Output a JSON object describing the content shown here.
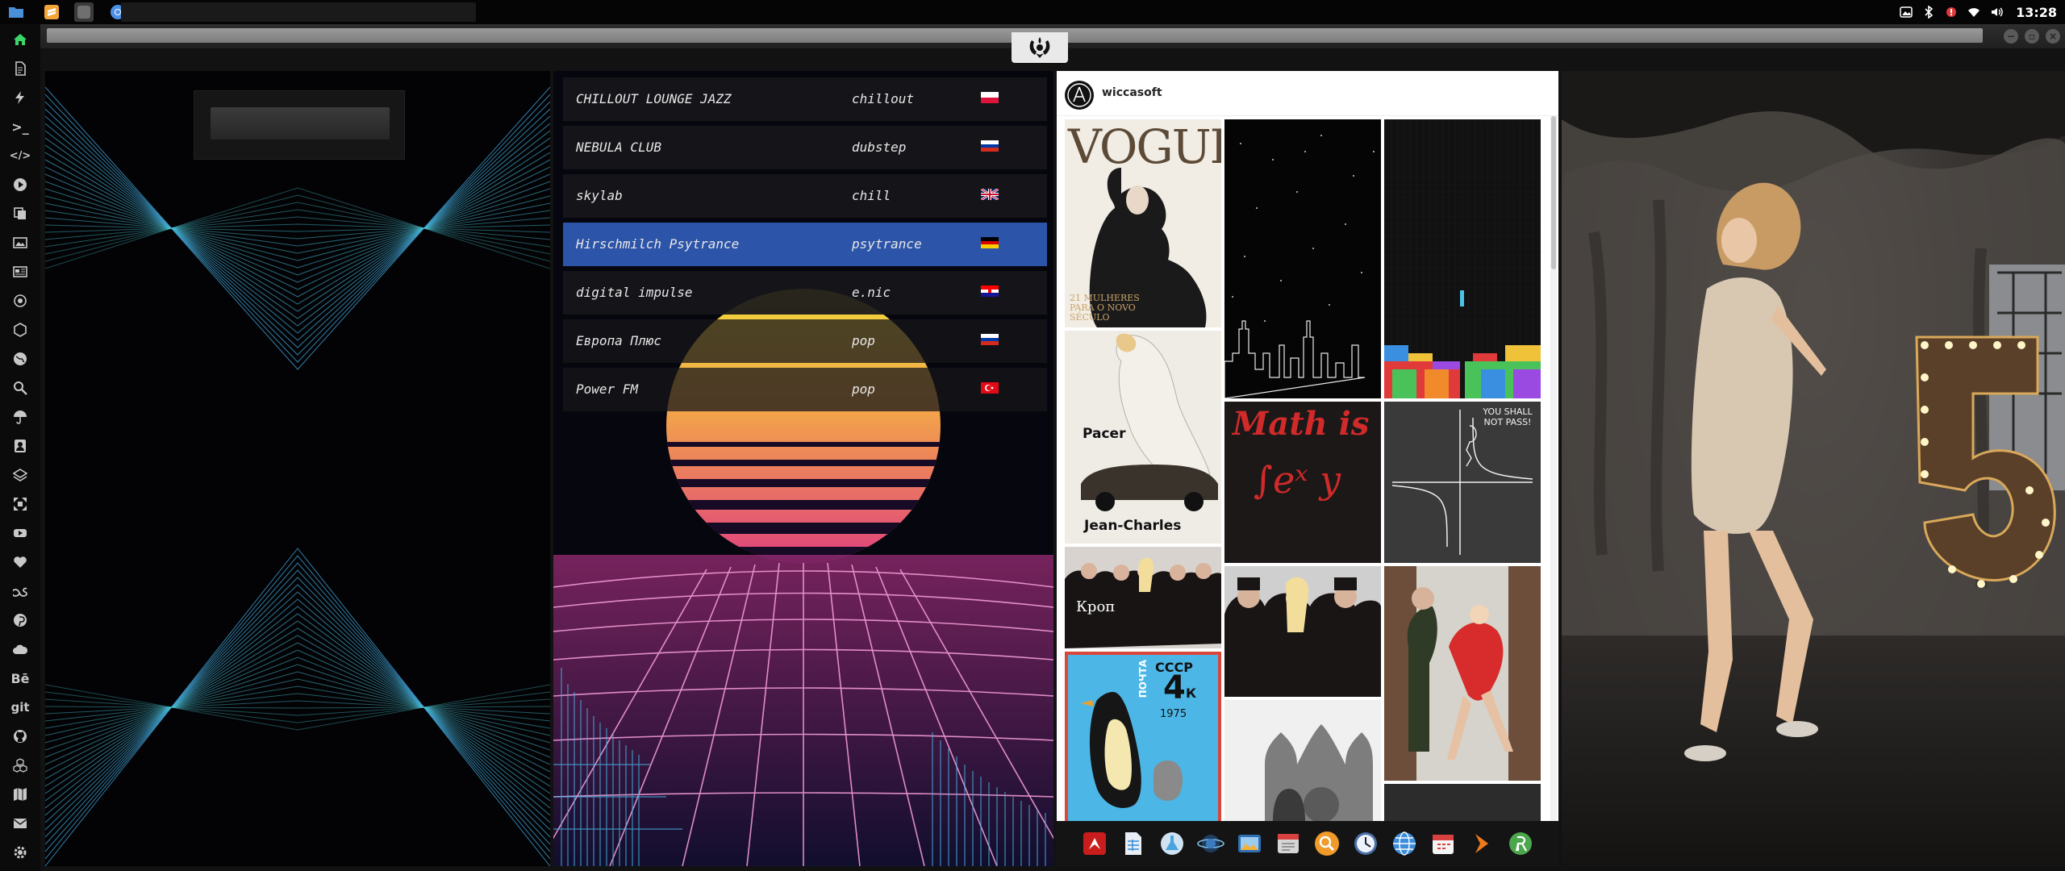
{
  "taskbar": {
    "apps": [
      {
        "icon": "folder-icon",
        "color": "#4a90d9"
      },
      {
        "icon": "sublime-text-icon",
        "color": "#f2a53a"
      },
      {
        "icon": "settings-app-icon",
        "color": "#6f6f6f"
      },
      {
        "icon": "chromium-icon",
        "color": "#4d8fe6"
      }
    ],
    "tray": [
      "picture-icon",
      "bluetooth-icon",
      "update-alert-icon",
      "wifi-icon",
      "volume-icon"
    ],
    "clock": "13:28"
  },
  "sidebar": {
    "items": [
      {
        "icon": "home-icon",
        "text": "",
        "color": "#3cd56a"
      },
      {
        "icon": "document-icon",
        "text": ""
      },
      {
        "icon": "lightning-icon",
        "text": ""
      },
      {
        "icon": "terminal-icon",
        "text": ">_"
      },
      {
        "icon": "code-icon",
        "text": "</>"
      },
      {
        "icon": "play-circle-icon",
        "text": ""
      },
      {
        "icon": "copy-icon",
        "text": ""
      },
      {
        "icon": "image-icon",
        "text": ""
      },
      {
        "icon": "newspaper-icon",
        "text": ""
      },
      {
        "icon": "sun-icon",
        "text": ""
      },
      {
        "icon": "hexagon-icon",
        "text": ""
      },
      {
        "icon": "globe-icon",
        "text": ""
      },
      {
        "icon": "search-icon",
        "text": ""
      },
      {
        "icon": "umbrella-icon",
        "text": ""
      },
      {
        "icon": "contact-icon",
        "text": ""
      },
      {
        "icon": "layers-icon",
        "text": ""
      },
      {
        "icon": "expand-icon",
        "text": ""
      },
      {
        "icon": "youtube-icon",
        "text": ""
      },
      {
        "icon": "heart-icon",
        "text": ""
      },
      {
        "icon": "lastfm-icon",
        "text": ""
      },
      {
        "icon": "pinterest-icon",
        "text": ""
      },
      {
        "icon": "cloud-icon",
        "text": ""
      },
      {
        "icon": "behance-icon",
        "text": "Bē"
      },
      {
        "icon": "git-icon",
        "text": "git"
      },
      {
        "icon": "github-icon",
        "text": ""
      },
      {
        "icon": "cubes-icon",
        "text": ""
      },
      {
        "icon": "map-icon",
        "text": ""
      },
      {
        "icon": "mail-icon",
        "text": ""
      },
      {
        "icon": "gear-icon",
        "text": ""
      }
    ]
  },
  "radio": {
    "stations": [
      {
        "name": "CHILLOUT LOUNGE JAZZ",
        "genre": "chillout",
        "flag": "pl",
        "active": false
      },
      {
        "name": "NEBULA CLUB",
        "genre": "dubstep",
        "flag": "ru",
        "active": false
      },
      {
        "name": "skylab",
        "genre": "chill",
        "flag": "gb",
        "active": false
      },
      {
        "name": "Hirschmilch Psytrance",
        "genre": "psytrance",
        "flag": "de",
        "active": true
      },
      {
        "name": "digital impulse",
        "genre": "e.nic",
        "flag": "hr",
        "active": false
      },
      {
        "name": "Европа Плюс",
        "genre": "pop",
        "flag": "ru",
        "active": false
      },
      {
        "name": "Power FM",
        "genre": "pop",
        "flag": "tr",
        "active": false
      }
    ]
  },
  "instagram": {
    "username": "wiccasoft",
    "tiles": {
      "vogue_title": "VOGUE",
      "vogue_sub": "21 MULHERES PARA O NOVO SÉCULO",
      "pacer_title": "Pacer",
      "pacer_brand": "Jean-Charles",
      "math_line1": "Math is",
      "math_line2": "∫eˣ y",
      "shall_text": "YOU SHALL NOT PASS!",
      "stamp_top": "ПОЧТА",
      "stamp_country": "СССР",
      "stamp_value": "4",
      "stamp_unit": "К",
      "stamp_year": "1975",
      "military_caption": "Кроп"
    }
  },
  "dock": {
    "apps": [
      {
        "icon": "adobe-reader-icon",
        "color": "#c91d1d"
      },
      {
        "icon": "spreadsheet-icon",
        "color": "#2f8bd6"
      },
      {
        "icon": "flask-icon",
        "color": "#4aa3df"
      },
      {
        "icon": "planet-icon",
        "color": "#3a7bbf"
      },
      {
        "icon": "photos-icon",
        "color": "#2f6fb2"
      },
      {
        "icon": "documents-icon",
        "color": "#d6d6d6"
      },
      {
        "icon": "magnifier-app-icon",
        "color": "#f09a2a"
      },
      {
        "icon": "clock-app-icon",
        "color": "#4b6fa8"
      },
      {
        "icon": "web-browser-icon",
        "color": "#3c8ddb"
      },
      {
        "icon": "calendar-icon",
        "color": "#d94141"
      },
      {
        "icon": "arrow-app-icon",
        "color": "#f07a1a"
      },
      {
        "icon": "yandex-icon",
        "color": "#4ca64c"
      }
    ]
  }
}
